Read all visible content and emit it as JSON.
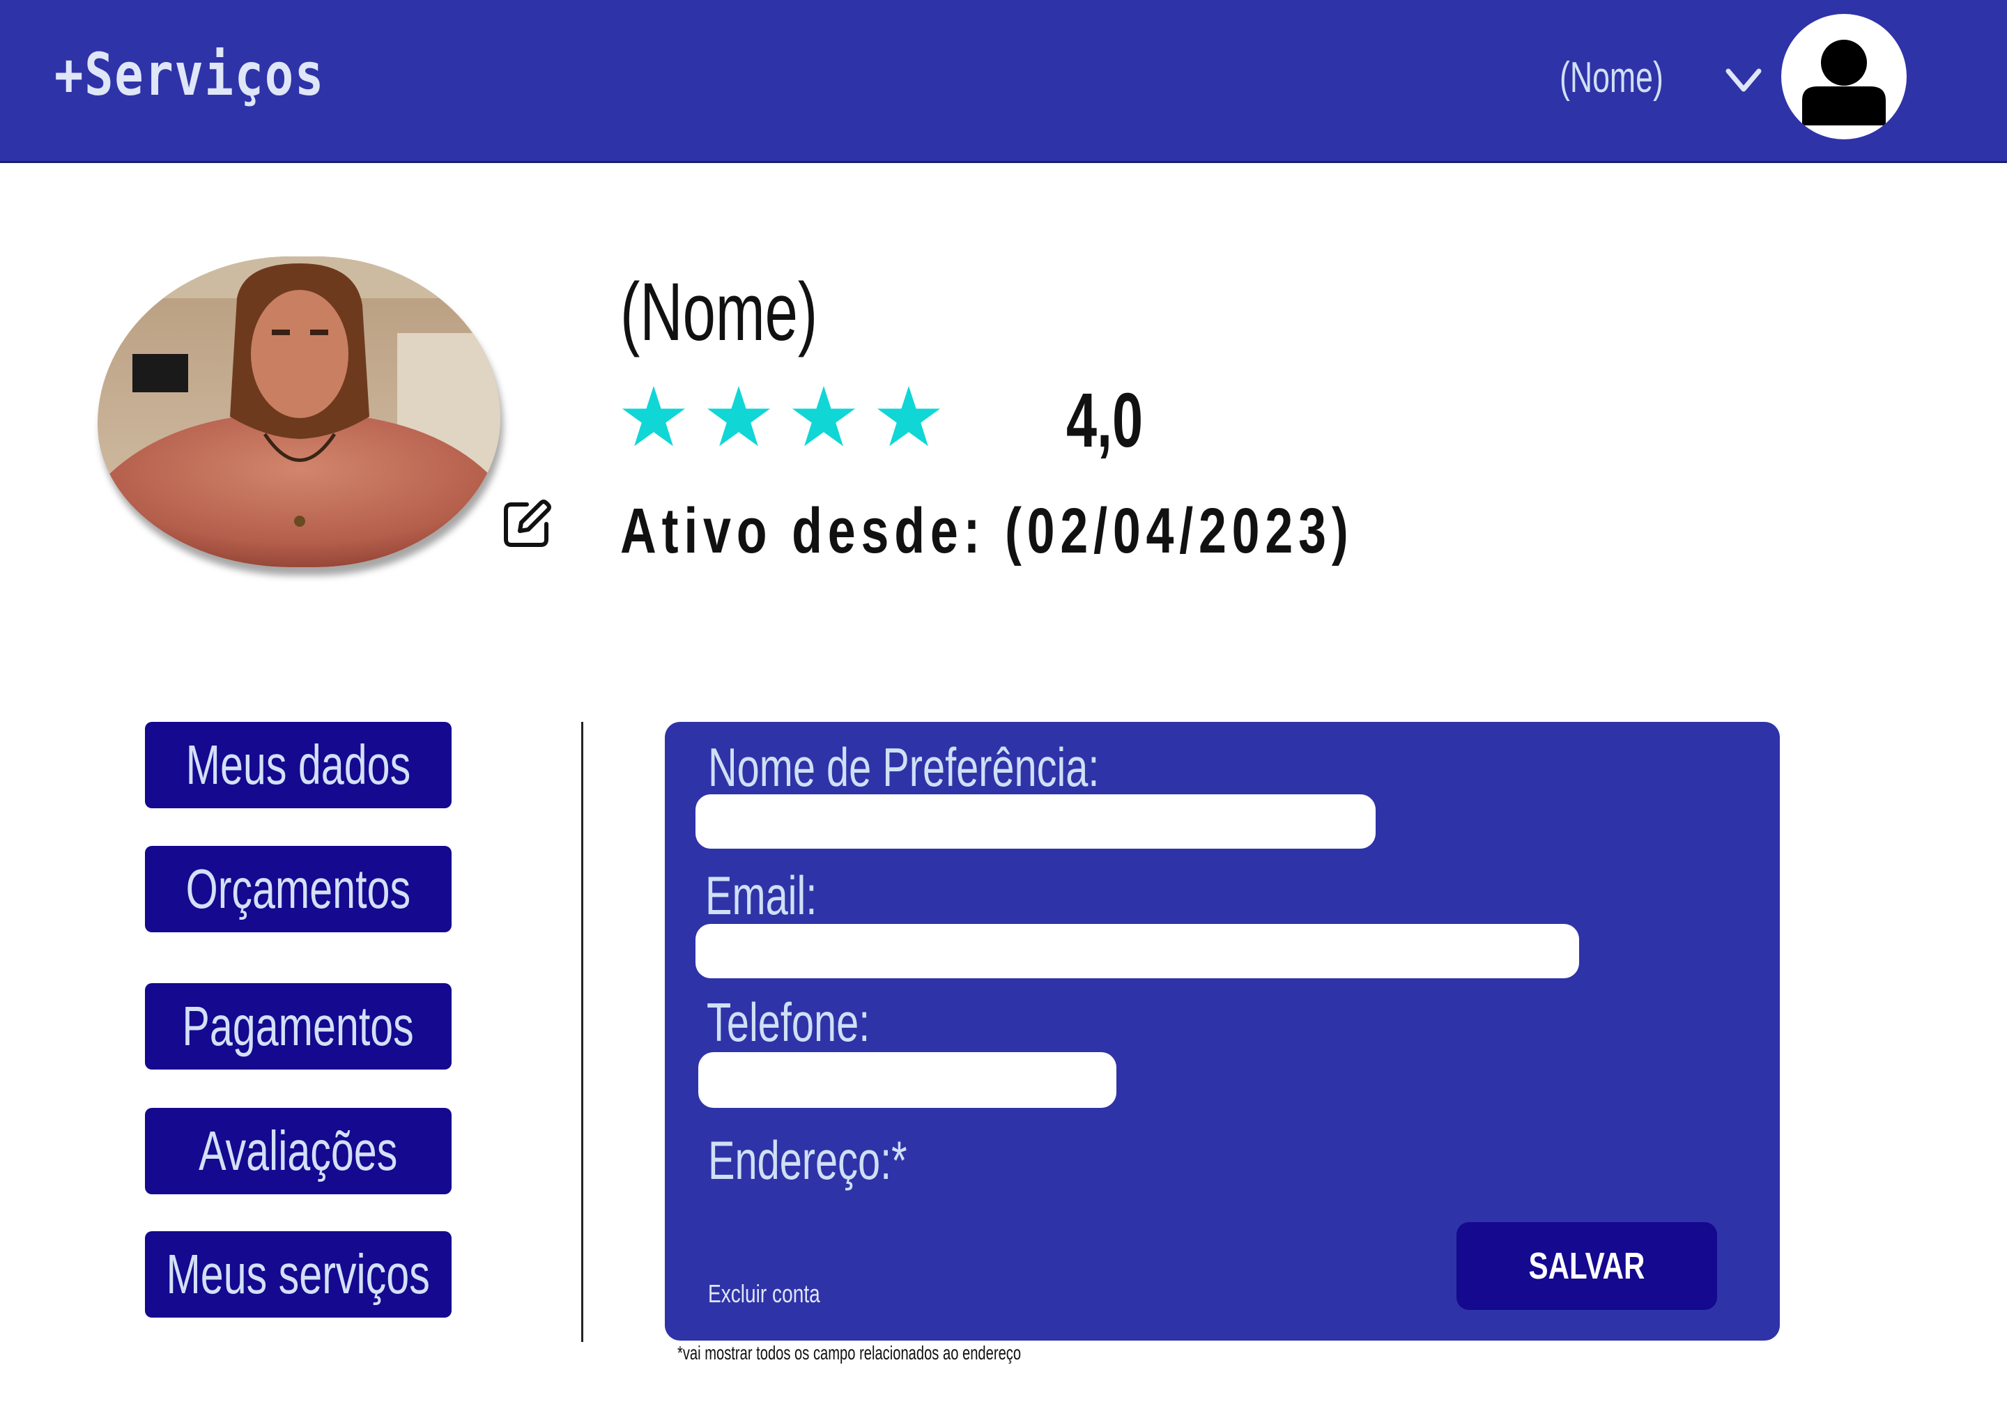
{
  "header": {
    "logo": "+Serviços",
    "user_name": "(Nome)",
    "dropdown_icon": "chevron-down-icon",
    "avatar_icon": "user-avatar-icon"
  },
  "profile": {
    "name": "(Nome)",
    "rating_stars": 4,
    "rating_max": 5,
    "rating_value": "4,0",
    "active_since": "Ativo desde: (02/04/2023)",
    "edit_icon": "edit-icon",
    "star_color": "#10d6d6"
  },
  "sidebar": {
    "items": [
      {
        "label": "Meus dados"
      },
      {
        "label": "Orçamentos"
      },
      {
        "label": "Pagamentos"
      },
      {
        "label": "Avaliações"
      },
      {
        "label": "Meus serviços"
      }
    ]
  },
  "form": {
    "fields": [
      {
        "label": "Nome de Preferência:",
        "value": "",
        "placeholder": ""
      },
      {
        "label": "Email:",
        "value": "",
        "placeholder": ""
      },
      {
        "label": "Telefone:",
        "value": "",
        "placeholder": ""
      }
    ],
    "address_label": "Endereço:*",
    "delete_account": "Excluir conta",
    "save_label": "SALVAR"
  },
  "footnote": "*vai mostrar todos os campo relacionados ao endereço",
  "colors": {
    "primary": "#2f33a8",
    "button": "#14098f",
    "label_text": "#cfe0f5"
  }
}
